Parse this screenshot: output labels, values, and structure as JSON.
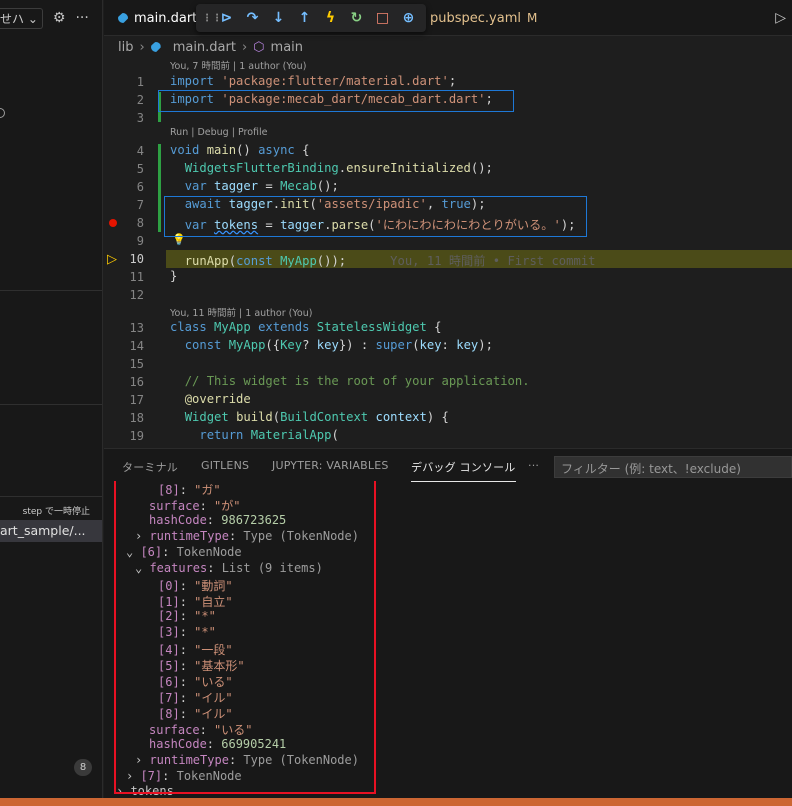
{
  "sidebar": {
    "top_select": "せハ",
    "step_label": "step で一時停止",
    "frame_label": "art_sample/...",
    "badge_count": "8"
  },
  "tabs": {
    "active": "main.dart",
    "other": "pubspec.yaml",
    "other_status": "M"
  },
  "breadcrumb": [
    "lib",
    "main.dart",
    "main"
  ],
  "code": {
    "lens_top": "You, 7 時間前 | 1 author (You)",
    "lens_run": "Run | Debug | Profile",
    "lens_class": "You, 11 時間前 | 1 author (You)",
    "line_numbers": [
      "1",
      "2",
      "3",
      "4",
      "5",
      "6",
      "7",
      "8",
      "9",
      "10",
      "11",
      "12",
      "13",
      "14",
      "15",
      "16",
      "17",
      "18",
      "19"
    ],
    "l1": {
      "kw": "import",
      "str": "'package:flutter/material.dart'",
      "end": ";"
    },
    "l2": {
      "kw": "import",
      "str": "'package:mecab_dart/mecab_dart.dart'",
      "end": ";"
    },
    "l4": {
      "kw": "void",
      "fn": "main",
      "p": "() ",
      "kw2": "async",
      "b": " {"
    },
    "l5": {
      "ty": "WidgetsFlutterBinding",
      "p": ".",
      "fn": "ensureInitialized",
      "end": "();"
    },
    "l6": {
      "kw": "var",
      "var": "tagger",
      "p": " = ",
      "ty": "Mecab",
      "end": "();"
    },
    "l7": {
      "kw": "await",
      "var": "tagger",
      "fn": "init",
      "str": "'assets/ipadic'",
      "kw2": "true",
      "end": ");"
    },
    "l8": {
      "kw": "var",
      "var": "tokens",
      "var2": "tagger",
      "fn": "parse",
      "str": "'にわにわにわにわとりがいる。'",
      "end": ");"
    },
    "l10": {
      "fn": "runApp",
      "kw": "const",
      "ty": "MyApp",
      "end": "());",
      "blame": "You, 11 時間前 • First commit"
    },
    "l11": "}",
    "l13": {
      "kw": "class",
      "ty": "MyApp",
      "kw2": "extends",
      "ty2": "StatelessWidget",
      "b": " {"
    },
    "l14": {
      "kw": "const",
      "ty": "MyApp",
      "p1": "({",
      "ty2": "Key",
      "p2": "? ",
      "var": "key",
      "p3": "}) : ",
      "kw2": "super",
      "p4": "(",
      "var2": "key",
      "p5": ": ",
      "var3": "key",
      "end": ");"
    },
    "l16": "// This widget is the root of your application.",
    "l17": "@override",
    "l18": {
      "ty": "Widget",
      "fn": "build",
      "ty2": "BuildContext",
      "var": "context",
      "end": ") {"
    },
    "l19": {
      "kw": "return",
      "ty": "MaterialApp",
      "end": "("
    }
  },
  "panel": {
    "tabs": [
      "ターミナル",
      "GITLENS",
      "JUPYTER: VARIABLES",
      "デバッグ コンソール",
      "···"
    ],
    "filter_placeholder": "フィルター (例: text、!exclude)",
    "console": [
      {
        "k": "[8]",
        "v": "\"ガ\""
      },
      {
        "k": "surface",
        "v": "\"が\""
      },
      {
        "k": "hashCode",
        "n": "986723625"
      },
      {
        "k": "runtimeType",
        "t": "Type (TokenNode)"
      },
      {
        "k": "[6]",
        "t": "TokenNode"
      },
      {
        "k": "features",
        "t": "List (9 items)"
      },
      {
        "k": "[0]",
        "v": "\"動詞\""
      },
      {
        "k": "[1]",
        "v": "\"自立\""
      },
      {
        "k": "[2]",
        "v": "\"*\""
      },
      {
        "k": "[3]",
        "v": "\"*\""
      },
      {
        "k": "[4]",
        "v": "\"一段\""
      },
      {
        "k": "[5]",
        "v": "\"基本形\""
      },
      {
        "k": "[6]",
        "v": "\"いる\""
      },
      {
        "k": "[7]",
        "v": "\"イル\""
      },
      {
        "k": "[8]",
        "v": "\"イル\""
      },
      {
        "k": "surface",
        "v": "\"いる\""
      },
      {
        "k": "hashCode",
        "n": "669905241"
      },
      {
        "k": "runtimeType",
        "t": "Type (TokenNode)"
      },
      {
        "k": "[7]",
        "t": "TokenNode"
      },
      {
        "k": "tokens"
      }
    ]
  },
  "colors": {
    "accent_box": "#1e78d6",
    "console_box": "#e81123",
    "statusbar": "#cc6633"
  }
}
